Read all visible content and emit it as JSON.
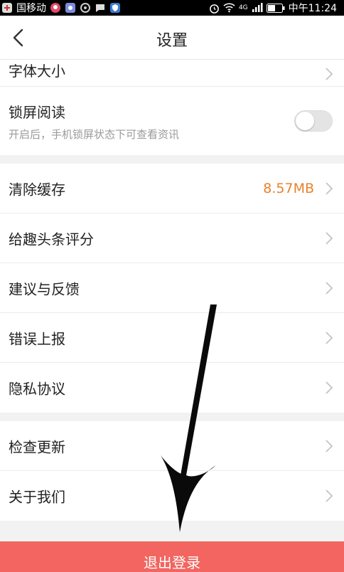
{
  "status_bar": {
    "carrier": "国移动",
    "time": "中午11:24",
    "network": "4G"
  },
  "nav": {
    "title": "设置"
  },
  "settings": {
    "font_size_label": "字体大小",
    "lock_screen": {
      "title": "锁屏阅读",
      "subtitle": "开启后，手机锁屏状态下可查看资讯",
      "enabled": false
    },
    "clear_cache": {
      "label": "清除缓存",
      "value": "8.57MB"
    },
    "rate_app_label": "给趣头条评分",
    "feedback_label": "建议与反馈",
    "error_report_label": "错误上报",
    "privacy_label": "隐私协议",
    "check_update_label": "检查更新",
    "about_label": "关于我们"
  },
  "logout_label": "退出登录",
  "colors": {
    "accent": "#e8822c",
    "logout_bg": "#f26560",
    "page_bg": "#f2f2f2"
  }
}
